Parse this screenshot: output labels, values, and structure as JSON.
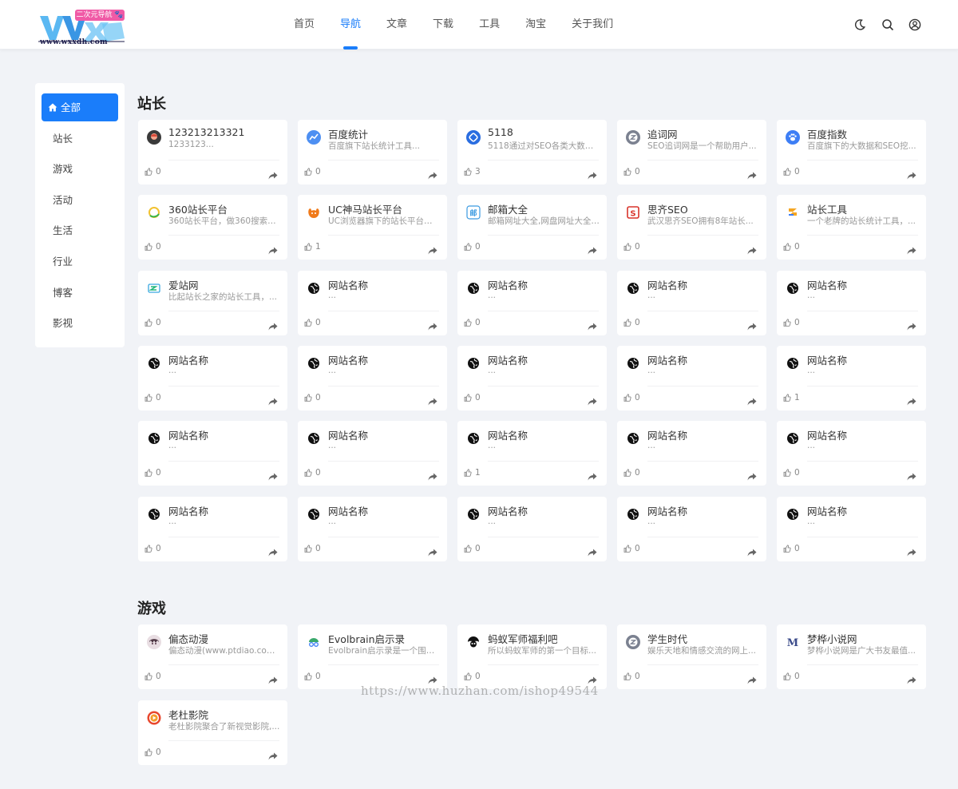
{
  "logo": {
    "brand": "WXX",
    "tag": "二次元导航 🐾",
    "url": "www.wxxdh.com"
  },
  "nav": [
    {
      "label": "首页",
      "active": false
    },
    {
      "label": "导航",
      "active": true
    },
    {
      "label": "文章",
      "active": false
    },
    {
      "label": "下载",
      "active": false
    },
    {
      "label": "工具",
      "active": false
    },
    {
      "label": "淘宝",
      "active": false
    },
    {
      "label": "关于我们",
      "active": false
    }
  ],
  "header_icons": [
    "moon-icon",
    "search-icon",
    "user-icon"
  ],
  "sidebar": [
    {
      "label": "全部",
      "active": true
    },
    {
      "label": "站长",
      "active": false
    },
    {
      "label": "游戏",
      "active": false
    },
    {
      "label": "活动",
      "active": false
    },
    {
      "label": "生活",
      "active": false
    },
    {
      "label": "行业",
      "active": false
    },
    {
      "label": "博客",
      "active": false
    },
    {
      "label": "影视",
      "active": false
    }
  ],
  "accent_color": "#1a7dfa",
  "sections": [
    {
      "title": "站长",
      "cards": [
        {
          "name": "123213213321",
          "desc": "1233123...",
          "likes": "0",
          "icon": "avatar-icon",
          "color": "#e5e5e5"
        },
        {
          "name": "百度统计",
          "desc": "百度旗下站长统计工具...",
          "likes": "0",
          "icon": "chart-icon",
          "color": "#4d8ff2"
        },
        {
          "name": "5118",
          "desc": "5118通过对SEO各类大数据...",
          "likes": "3",
          "icon": "5118-icon",
          "color": "#2a6de0"
        },
        {
          "name": "追词网",
          "desc": "SEO追词网是一个帮助用户...",
          "likes": "0",
          "icon": "z-icon",
          "color": "#7b8190"
        },
        {
          "name": "百度指数",
          "desc": "百度旗下的大数据和SEO挖...",
          "likes": "0",
          "icon": "paw-icon",
          "color": "#3d7ef5"
        },
        {
          "name": "360站长平台",
          "desc": "360站长平台，做360搜索引...",
          "likes": "0",
          "icon": "360-icon",
          "color": "#f2c230"
        },
        {
          "name": "UC神马站长平台",
          "desc": "UC浏览器旗下的站长平台，...",
          "likes": "1",
          "icon": "uc-icon",
          "color": "#f07a1a"
        },
        {
          "name": "邮箱大全",
          "desc": "邮箱网址大全,网盘网址大全,...",
          "likes": "0",
          "icon": "mail-icon",
          "color": "#3b9ae1"
        },
        {
          "name": "思齐SEO",
          "desc": "武汉思齐SEO拥有8年站长...",
          "likes": "0",
          "icon": "s-icon",
          "color": "#d9342b"
        },
        {
          "name": "站长工具",
          "desc": "一个老牌的站长统计工具，...",
          "likes": "0",
          "icon": "z-tool-icon",
          "color": "#f5a623"
        },
        {
          "name": "爱站网",
          "desc": "比起站长之家的站长工具，...",
          "likes": "0",
          "icon": "aizhan-icon",
          "color": "#20b57a"
        },
        {
          "name": "网站名称",
          "desc": "...",
          "likes": "0",
          "icon": "globe-icon",
          "color": "#111"
        },
        {
          "name": "网站名称",
          "desc": "...",
          "likes": "0",
          "icon": "globe-icon",
          "color": "#111"
        },
        {
          "name": "网站名称",
          "desc": "...",
          "likes": "0",
          "icon": "globe-icon",
          "color": "#111"
        },
        {
          "name": "网站名称",
          "desc": "...",
          "likes": "0",
          "icon": "globe-icon",
          "color": "#111"
        },
        {
          "name": "网站名称",
          "desc": "...",
          "likes": "0",
          "icon": "globe-icon",
          "color": "#111"
        },
        {
          "name": "网站名称",
          "desc": "...",
          "likes": "0",
          "icon": "globe-icon",
          "color": "#111"
        },
        {
          "name": "网站名称",
          "desc": "...",
          "likes": "0",
          "icon": "globe-icon",
          "color": "#111"
        },
        {
          "name": "网站名称",
          "desc": "...",
          "likes": "0",
          "icon": "globe-icon",
          "color": "#111"
        },
        {
          "name": "网站名称",
          "desc": "...",
          "likes": "1",
          "icon": "globe-icon",
          "color": "#111"
        },
        {
          "name": "网站名称",
          "desc": "...",
          "likes": "0",
          "icon": "globe-icon",
          "color": "#111"
        },
        {
          "name": "网站名称",
          "desc": "...",
          "likes": "0",
          "icon": "globe-icon",
          "color": "#111"
        },
        {
          "name": "网站名称",
          "desc": "...",
          "likes": "1",
          "icon": "globe-icon",
          "color": "#111"
        },
        {
          "name": "网站名称",
          "desc": "...",
          "likes": "0",
          "icon": "globe-icon",
          "color": "#111"
        },
        {
          "name": "网站名称",
          "desc": "...",
          "likes": "0",
          "icon": "globe-icon",
          "color": "#111"
        },
        {
          "name": "网站名称",
          "desc": "...",
          "likes": "0",
          "icon": "globe-icon",
          "color": "#111"
        },
        {
          "name": "网站名称",
          "desc": "...",
          "likes": "0",
          "icon": "globe-icon",
          "color": "#111"
        },
        {
          "name": "网站名称",
          "desc": "...",
          "likes": "0",
          "icon": "globe-icon",
          "color": "#111"
        },
        {
          "name": "网站名称",
          "desc": "...",
          "likes": "0",
          "icon": "globe-icon",
          "color": "#111"
        },
        {
          "name": "网站名称",
          "desc": "...",
          "likes": "0",
          "icon": "globe-icon",
          "color": "#111"
        }
      ]
    },
    {
      "title": "游戏",
      "cards": [
        {
          "name": "偏态动漫",
          "desc": "偏态动漫(www.ptdiao.com)...",
          "likes": "0",
          "icon": "anime-avatar-icon",
          "color": "#c2a4b0"
        },
        {
          "name": "Evolbrain启示录",
          "desc": "Evolbrain启示录是一个围绕...",
          "likes": "0",
          "icon": "brain-icon",
          "color": "#39a86b"
        },
        {
          "name": "蚂蚁军师福利吧",
          "desc": "所以蚂蚁军师的第一个目标...",
          "likes": "0",
          "icon": "ant-icon",
          "color": "#222"
        },
        {
          "name": "学生时代",
          "desc": "娱乐天地和情感交流的网上...",
          "likes": "0",
          "icon": "z-icon",
          "color": "#7b8190"
        },
        {
          "name": "梦桦小说网",
          "desc": "梦桦小说网是广大书友最值...",
          "likes": "0",
          "icon": "m-icon",
          "color": "#ffffff"
        },
        {
          "name": "老杜影院",
          "desc": "老杜影院聚合了新视觉影院,...",
          "likes": "0",
          "icon": "play-icon",
          "color": "#e8472d"
        }
      ]
    }
  ],
  "watermark": "https://www.huzhan.com/ishop49544"
}
